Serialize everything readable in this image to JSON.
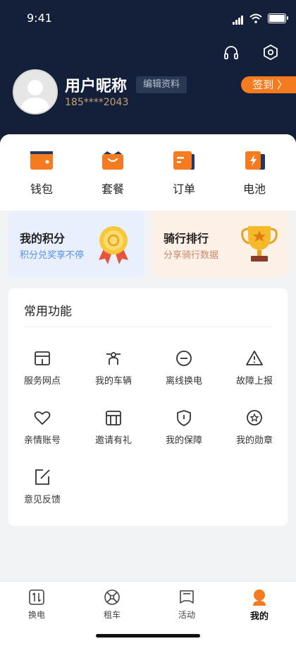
{
  "status_bar": {
    "time": "9:41"
  },
  "profile": {
    "nickname": "用户昵称",
    "edit_label": "编辑资料",
    "phone": "185****2043",
    "checkin_label": "签到 〉"
  },
  "top_icons": {
    "support": "headset-icon",
    "settings": "settings-icon"
  },
  "quick_actions": [
    {
      "label": "钱包",
      "icon": "wallet-icon"
    },
    {
      "label": "套餐",
      "icon": "package-icon"
    },
    {
      "label": "订单",
      "icon": "order-icon"
    },
    {
      "label": "电池",
      "icon": "battery-icon"
    }
  ],
  "promos": {
    "points": {
      "title": "我的积分",
      "subtitle": "积分兑奖享不停",
      "color": "#5b8ee8"
    },
    "ranking": {
      "title": "骑行排行",
      "subtitle": "分享骑行数据",
      "color": "#c8886c"
    }
  },
  "features": {
    "title": "常用功能",
    "items": [
      {
        "label": "服务网点",
        "icon": "store-icon"
      },
      {
        "label": "我的车辆",
        "icon": "vehicle-icon"
      },
      {
        "label": "离线换电",
        "icon": "offline-swap-icon"
      },
      {
        "label": "故障上报",
        "icon": "warning-icon"
      },
      {
        "label": "亲情账号",
        "icon": "heart-icon"
      },
      {
        "label": "邀请有礼",
        "icon": "gift-icon"
      },
      {
        "label": "我的保障",
        "icon": "shield-icon"
      },
      {
        "label": "我的勋章",
        "icon": "medal-icon"
      },
      {
        "label": "意见反馈",
        "icon": "feedback-icon"
      }
    ]
  },
  "tabbar": {
    "items": [
      {
        "label": "换电",
        "icon": "swap-icon"
      },
      {
        "label": "租车",
        "icon": "wheel-icon"
      },
      {
        "label": "活动",
        "icon": "activity-icon"
      },
      {
        "label": "我的",
        "icon": "profile-icon",
        "active": true
      }
    ]
  },
  "colors": {
    "header_bg": "#14203a",
    "accent": "#f47b20",
    "phone": "#c8a070"
  }
}
